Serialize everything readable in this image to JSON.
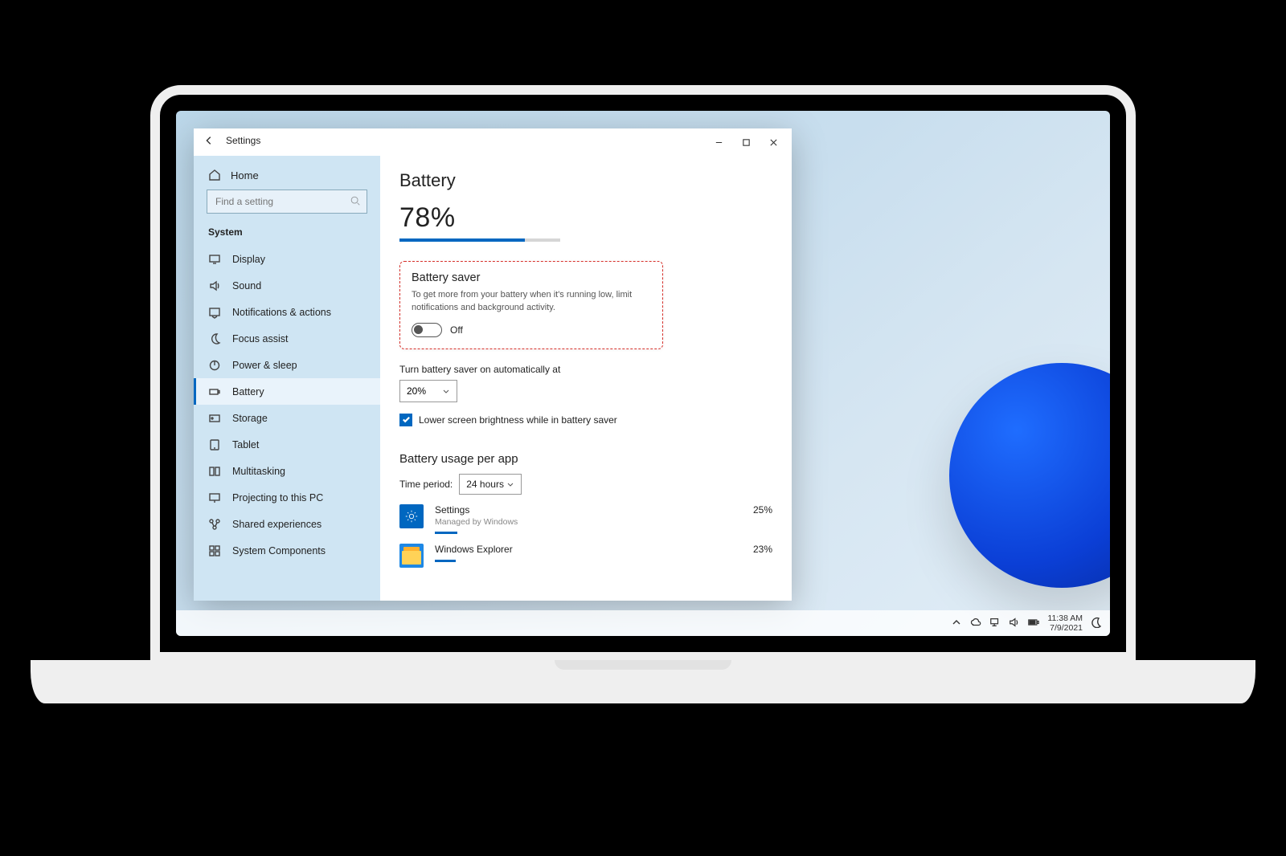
{
  "window": {
    "app_title": "Settings",
    "controls": {
      "min": "–",
      "max": "□",
      "close": "×"
    }
  },
  "sidebar": {
    "home": "Home",
    "search_placeholder": "Find a setting",
    "section": "System",
    "items": [
      {
        "icon": "display",
        "label": "Display"
      },
      {
        "icon": "sound",
        "label": "Sound"
      },
      {
        "icon": "notifications",
        "label": "Notifications & actions"
      },
      {
        "icon": "focus",
        "label": "Focus assist"
      },
      {
        "icon": "power",
        "label": "Power & sleep"
      },
      {
        "icon": "battery",
        "label": "Battery",
        "active": true
      },
      {
        "icon": "storage",
        "label": "Storage"
      },
      {
        "icon": "tablet",
        "label": "Tablet"
      },
      {
        "icon": "multitask",
        "label": "Multitasking"
      },
      {
        "icon": "project",
        "label": "Projecting to this PC"
      },
      {
        "icon": "shared",
        "label": "Shared experiences"
      },
      {
        "icon": "components",
        "label": "System Components"
      }
    ]
  },
  "content": {
    "title": "Battery",
    "percent_text": "78%",
    "percent_value": 78,
    "saver": {
      "heading": "Battery saver",
      "desc": "To get more from your battery when it's running low, limit notifications and background activity.",
      "state": "Off"
    },
    "auto_label": "Turn battery saver on automatically at",
    "auto_value": "20%",
    "brightness_check": "Lower screen brightness while in battery saver",
    "usage": {
      "heading": "Battery usage per app",
      "period_label": "Time period:",
      "period_value": "24 hours",
      "apps": [
        {
          "name": "Settings",
          "sub": "Managed by Windows",
          "pct": "25%"
        },
        {
          "name": "Windows Explorer",
          "sub": "",
          "pct": "23%"
        }
      ]
    }
  },
  "taskbar": {
    "time": "11:38 AM",
    "date": "7/9/2021"
  }
}
